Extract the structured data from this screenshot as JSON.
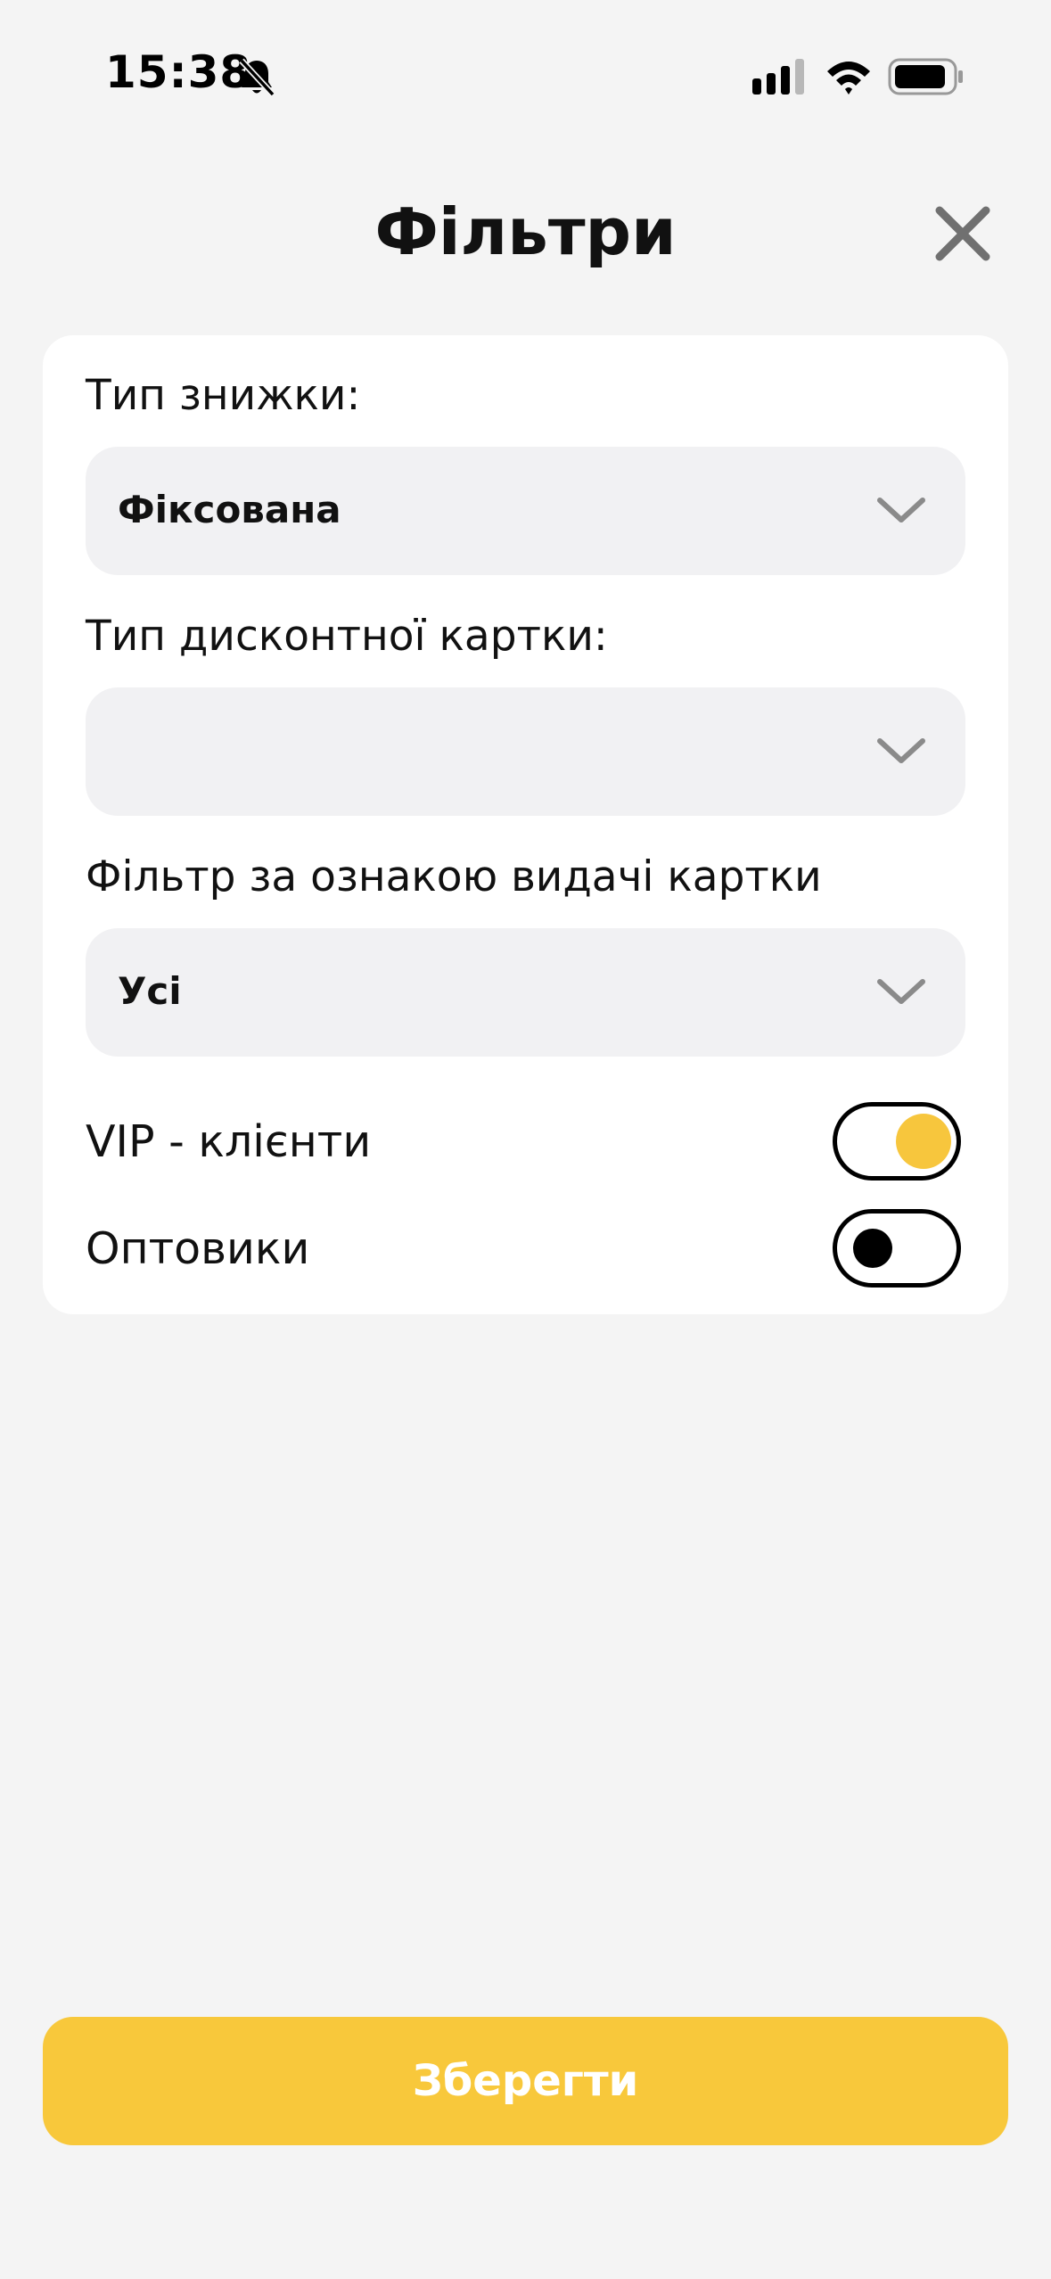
{
  "status_bar": {
    "time": "15:38",
    "icons": [
      "bell-slash-icon",
      "signal-icon",
      "wifi-icon",
      "battery-icon"
    ]
  },
  "header": {
    "title": "Фільтри",
    "close_icon": "close-icon"
  },
  "filters": {
    "discount_type": {
      "label": "Тип знижки:",
      "value": "Фіксована"
    },
    "card_type": {
      "label": "Тип дисконтної картки:",
      "value": ""
    },
    "card_issue_filter": {
      "label": "Фільтр за ознакою видачі картки",
      "value": "Усі"
    },
    "vip_clients": {
      "label": "VIP - клієнти",
      "enabled": true
    },
    "wholesalers": {
      "label": "Оптовики",
      "enabled": false
    }
  },
  "footer": {
    "save_label": "Зберегти"
  },
  "colors": {
    "accent": "#f8c83b",
    "background": "#f4f4f4",
    "card": "#ffffff",
    "select_bg": "#f1f1f3"
  }
}
